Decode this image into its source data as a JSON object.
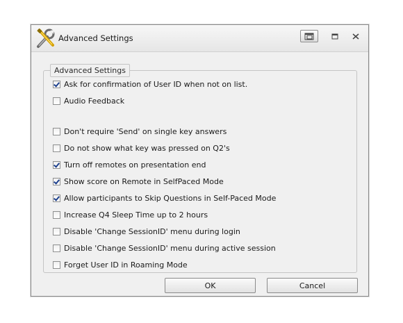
{
  "window": {
    "title": "Advanced Settings",
    "icon": "tools-icon"
  },
  "group": {
    "label": "Advanced Settings"
  },
  "options": [
    {
      "label": "Ask for confirmation of User ID when not on list.",
      "checked": true
    },
    {
      "label": "Audio Feedback",
      "checked": false
    },
    {
      "label": "Don't require 'Send' on single key answers",
      "checked": false
    },
    {
      "label": "Do not show what key was pressed on Q2's",
      "checked": false
    },
    {
      "label": "Turn off remotes on presentation end",
      "checked": true
    },
    {
      "label": "Show score on Remote in SelfPaced Mode",
      "checked": true
    },
    {
      "label": "Allow participants to Skip Questions in Self-Paced Mode",
      "checked": true
    },
    {
      "label": "Increase Q4 Sleep Time up to 2 hours",
      "checked": false
    },
    {
      "label": "Disable 'Change SessionID' menu during login",
      "checked": false
    },
    {
      "label": "Disable 'Change SessionID' menu during active session",
      "checked": false
    },
    {
      "label": "Forget User ID in Roaming Mode",
      "checked": false
    }
  ],
  "buttons": {
    "ok": "OK",
    "cancel": "Cancel"
  }
}
